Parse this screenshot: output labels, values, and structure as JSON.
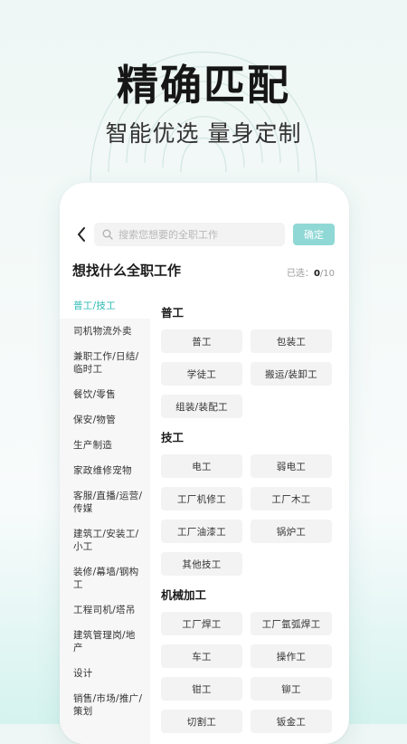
{
  "hero": {
    "title": "精确匹配",
    "subtitle": "智能优选 量身定制"
  },
  "topbar": {
    "back_icon": "chevron-left-icon",
    "search_icon": "search-icon",
    "search_placeholder": "搜索您想要的全职工作",
    "confirm_label": "确定"
  },
  "header": {
    "title": "想找什么全职工作",
    "selected_prefix": "已选：",
    "selected_count": "0",
    "selected_total": "/10"
  },
  "categories": [
    "普工/技工",
    "司机物流外卖",
    "兼职工作/日结/临时工",
    "餐饮/零售",
    "保安/物管",
    "生产制造",
    "家政维修宠物",
    "客服/直播/运营/传媒",
    "建筑工/安装工/小工",
    "装修/幕墙/钢构工",
    "工程司机/塔吊",
    "建筑管理岗/地产",
    "设计",
    "销售/市场/推广/策划"
  ],
  "sections": [
    {
      "title": "普工",
      "tags": [
        "普工",
        "包装工",
        "学徒工",
        "搬运/装卸工",
        "组装/装配工"
      ]
    },
    {
      "title": "技工",
      "tags": [
        "电工",
        "弱电工",
        "工厂机修工",
        "工厂木工",
        "工厂油漆工",
        "锅炉工",
        "其他技工"
      ]
    },
    {
      "title": "机械加工",
      "tags": [
        "工厂焊工",
        "工厂氩弧焊工",
        "车工",
        "操作工",
        "钳工",
        "铆工",
        "切割工",
        "钣金工"
      ]
    }
  ],
  "colors": {
    "accent": "#2dbab5",
    "confirm_bg": "#8fd8d5"
  }
}
